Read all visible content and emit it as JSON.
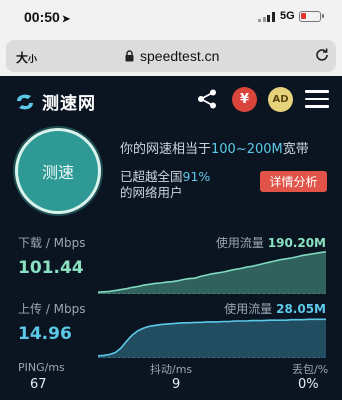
{
  "status_bar": {
    "time": "00:50",
    "network": "5G"
  },
  "url_bar": {
    "font_size_label_big": "大",
    "font_size_label_small": "小",
    "url": "speedtest.cn"
  },
  "header": {
    "logo_text": "测速网",
    "yen_label": "¥",
    "ad_label": "AD"
  },
  "speedtest": {
    "button_label": "测速",
    "line1_prefix": "你的网速相当于",
    "line1_highlight": "100~200M",
    "line1_suffix": "宽带",
    "line2_prefix": "已超越全国",
    "line2_highlight": "91%",
    "line3": "的网络用户",
    "detail_button": "详情分析"
  },
  "download": {
    "label": "下载 / Mbps",
    "value": "101.44",
    "usage_label": "使用流量",
    "usage_value": "190.20M",
    "series": [
      0.04,
      0.05,
      0.06,
      0.08,
      0.1,
      0.12,
      0.15,
      0.17,
      0.2,
      0.22,
      0.24,
      0.25,
      0.27,
      0.28,
      0.3,
      0.33,
      0.35,
      0.36,
      0.4,
      0.43,
      0.46,
      0.48,
      0.5,
      0.53,
      0.56,
      0.58,
      0.61,
      0.63,
      0.66,
      0.69,
      0.72,
      0.75,
      0.78,
      0.8,
      0.82,
      0.85,
      0.88,
      0.9,
      0.92,
      0.94,
      0.96
    ]
  },
  "upload": {
    "label": "上传 / Mbps",
    "value": "14.96",
    "usage_label": "使用流量",
    "usage_value": "28.05M",
    "series": [
      0.05,
      0.06,
      0.08,
      0.12,
      0.22,
      0.38,
      0.52,
      0.62,
      0.68,
      0.72,
      0.74,
      0.76,
      0.77,
      0.78,
      0.79,
      0.8,
      0.8,
      0.81,
      0.81,
      0.82,
      0.82,
      0.82,
      0.83,
      0.83,
      0.84,
      0.84,
      0.84,
      0.85,
      0.85,
      0.85,
      0.86,
      0.86,
      0.86,
      0.86,
      0.87,
      0.87,
      0.87,
      0.88,
      0.88,
      0.88,
      0.88
    ]
  },
  "stats": {
    "ping_label": "PING/ms",
    "ping_value": "67",
    "jitter_label": "抖动/ms",
    "jitter_value": "9",
    "loss_label": "丢包/%",
    "loss_value": "0%"
  },
  "colors": {
    "background": "#0b1522",
    "download_value": "#8be0c2",
    "upload_value": "#5dc9e8",
    "accent_red": "#e2544a",
    "circle": "#2f9a95"
  },
  "icons": {
    "location": "location-arrow-icon",
    "signal": "signal-icon",
    "battery": "battery-icon",
    "lock": "lock-icon",
    "reload": "reload-icon",
    "logo": "speedtest-logo-icon",
    "share": "share-icon",
    "menu": "menu-icon"
  }
}
